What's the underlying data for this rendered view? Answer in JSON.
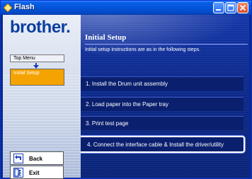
{
  "window": {
    "title": "Flash",
    "min_label": "—",
    "max_label": "□",
    "close_label": "✕"
  },
  "brand": {
    "logo": "brother."
  },
  "nav": {
    "top_menu": "Top Menu",
    "current": "Initial Setup"
  },
  "main": {
    "title": "Initial Setup",
    "subtitle": "Initial setup instructions are as in the following steps.",
    "steps": [
      "1. Install the Drum unit assembly",
      "2. Load paper into the Paper tray",
      "3. Print test page",
      "4. Connect the interface cable & Install the driver/utility"
    ]
  },
  "buttons": {
    "back": "Back",
    "exit": "Exit"
  },
  "icons": {
    "app": "flash-icon",
    "nav_arrow": "down-arrow-icon",
    "back": "back-arrow-icon",
    "exit": "exit-icon"
  },
  "colors": {
    "titlebar": "#0454d8",
    "sidebar": "#cdd7ea",
    "nav_current": "#f5a300",
    "main_bg": "#0d2a8e",
    "step_bg": "#0a1f6e",
    "logo": "#0b3fa0"
  }
}
